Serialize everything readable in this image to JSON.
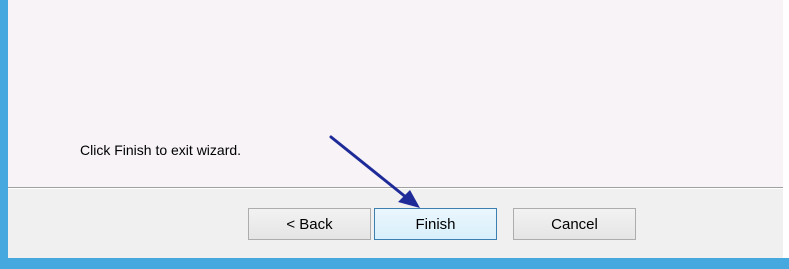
{
  "wizard": {
    "message": "Click Finish to exit wizard."
  },
  "buttons": {
    "back_label": "< Back",
    "finish_label": "Finish",
    "cancel_label": "Cancel"
  },
  "annotation": {
    "icon": "arrow-pointer-icon",
    "color": "#1f2a99"
  },
  "colors": {
    "frame_accent": "#45a9df",
    "pane_background": "#f7f3f7",
    "button_bar_background": "#f0f0f0"
  }
}
